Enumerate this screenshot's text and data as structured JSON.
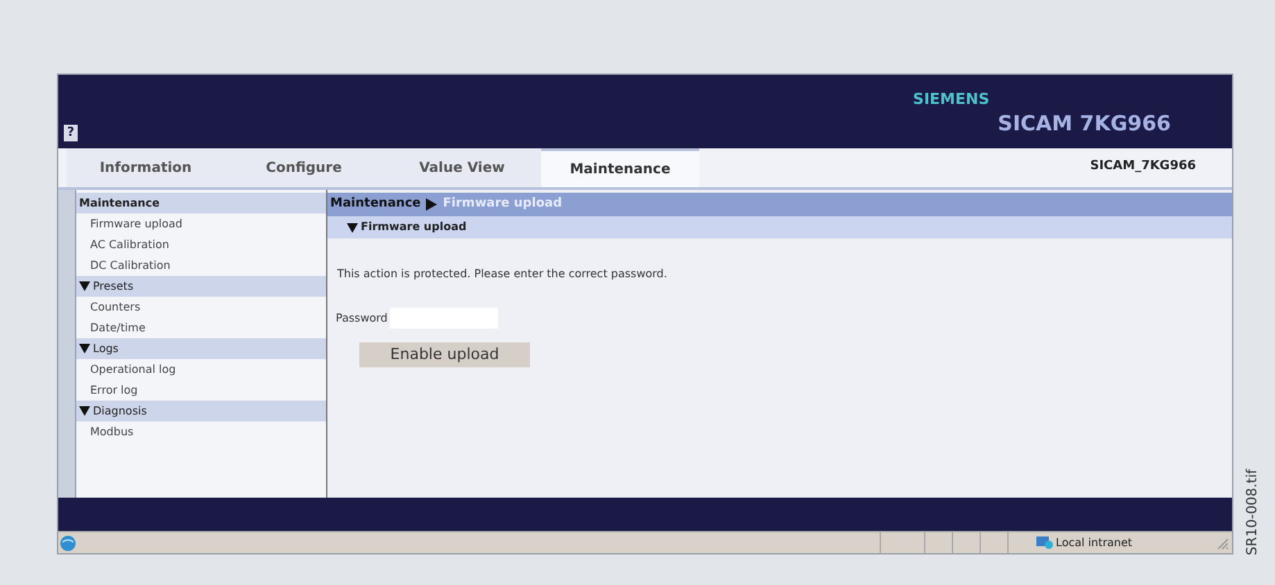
{
  "header": {
    "help": "?",
    "brand": "SIEMENS",
    "product": "SICAM 7KG966"
  },
  "tabs": [
    {
      "label": "Information",
      "selected": false
    },
    {
      "label": "Configure",
      "selected": false
    },
    {
      "label": "Value View",
      "selected": false
    },
    {
      "label": "Maintenance",
      "selected": true
    }
  ],
  "device_name": "SICAM_7KG966",
  "sidebar": {
    "sections": [
      {
        "kind": "heading",
        "title": "Maintenance",
        "items": [
          "Firmware upload",
          "AC Calibration",
          "DC Calibration"
        ]
      },
      {
        "kind": "group",
        "title": "Presets",
        "items": [
          "Counters",
          "Date/time"
        ]
      },
      {
        "kind": "group",
        "title": "Logs",
        "items": [
          "Operational log",
          "Error log"
        ]
      },
      {
        "kind": "group",
        "title": "Diagnosis",
        "items": [
          "Modbus"
        ]
      }
    ]
  },
  "breadcrumb": {
    "parent": "Maintenance",
    "current": "Firmware upload"
  },
  "section_title": "Firmware upload",
  "message": "This action is protected. Please enter the correct password.",
  "password": {
    "label": "Password"
  },
  "enable_button": "Enable upload",
  "status_bar": {
    "zone": "Local intranet"
  },
  "figure_label": "SR10-008.tif"
}
